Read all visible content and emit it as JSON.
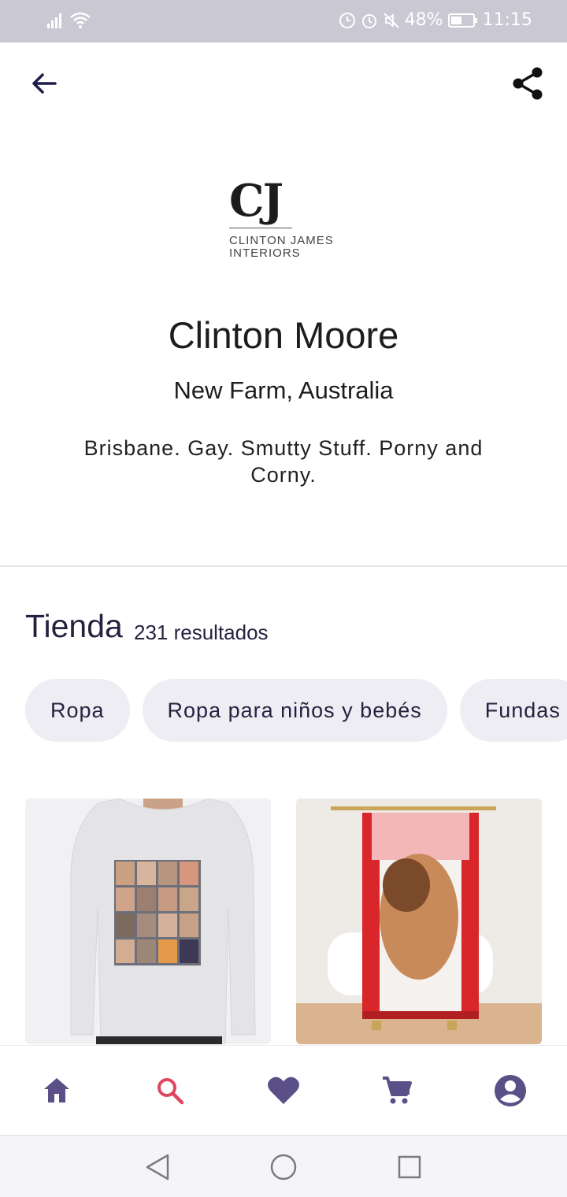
{
  "status_bar": {
    "battery": "48%",
    "time": "11:15",
    "icons": [
      "signal-icon",
      "wifi-icon",
      "data-saver-icon",
      "alarm-icon",
      "mute-icon",
      "battery-icon"
    ]
  },
  "top_bar": {
    "icons": [
      "back-arrow-icon",
      "share-icon"
    ]
  },
  "logo": {
    "mark": "CJ",
    "line1": "CLINTON JAMES",
    "line2": "INTERIORS"
  },
  "profile": {
    "name": "Clinton Moore",
    "location": "New Farm, Australia",
    "bio": "Brisbane. Gay. Smutty Stuff. Porny and Corny."
  },
  "shop": {
    "title": "Tienda",
    "count": "231 resultados",
    "categories": [
      "Ropa",
      "Ropa para niños y bebés",
      "Fundas"
    ]
  },
  "products": [
    {
      "type": "long-sleeve-tshirt",
      "image": "mugshot-collage-tshirt"
    },
    {
      "type": "shower-curtain",
      "image": "daddad-shower-curtain"
    }
  ],
  "bottom_nav": {
    "items": [
      "home-icon",
      "search-icon",
      "heart-icon",
      "cart-icon",
      "account-icon"
    ],
    "active": "search-icon",
    "colors": {
      "default": "#5b4f88",
      "active": "#e0475e"
    }
  },
  "system_nav": {
    "items": [
      "back-triangle-icon",
      "home-circle-icon",
      "recents-square-icon"
    ]
  },
  "colors": {
    "status_bar": "#c9c8d3",
    "text_dark": "#252240",
    "chip_bg": "#eeedf3"
  }
}
